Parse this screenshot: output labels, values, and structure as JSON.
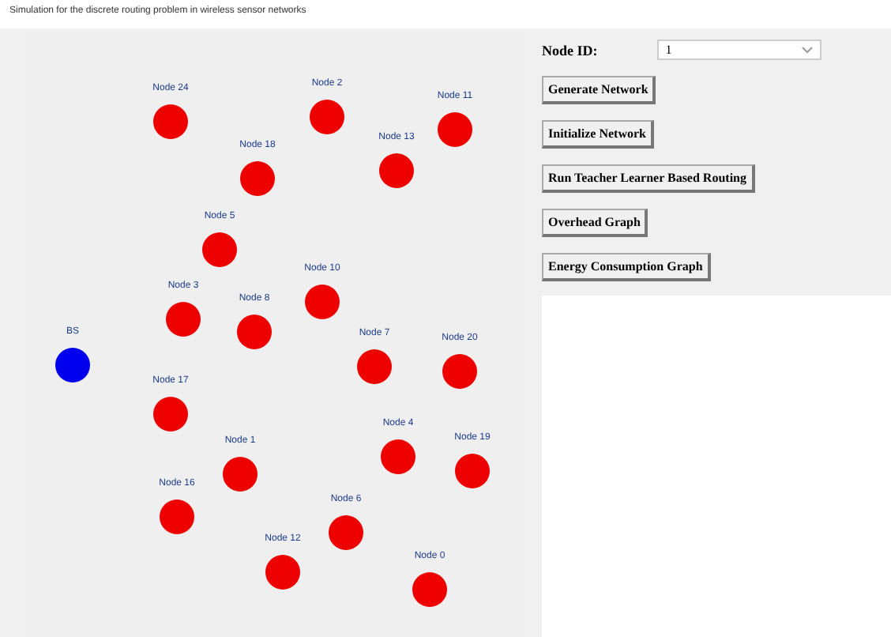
{
  "window": {
    "title": "Simulation for the discrete routing problem in wireless sensor networks"
  },
  "network": {
    "nodes": [
      {
        "label": "Node 24",
        "kind": "sensor"
      },
      {
        "label": "Node 2",
        "kind": "sensor"
      },
      {
        "label": "Node 11",
        "kind": "sensor"
      },
      {
        "label": "Node 18",
        "kind": "sensor"
      },
      {
        "label": "Node 13",
        "kind": "sensor"
      },
      {
        "label": "Node 5",
        "kind": "sensor"
      },
      {
        "label": "Node 3",
        "kind": "sensor"
      },
      {
        "label": "Node 8",
        "kind": "sensor"
      },
      {
        "label": "Node 10",
        "kind": "sensor"
      },
      {
        "label": "BS",
        "kind": "base_station"
      },
      {
        "label": "Node 7",
        "kind": "sensor"
      },
      {
        "label": "Node 20",
        "kind": "sensor"
      },
      {
        "label": "Node 17",
        "kind": "sensor"
      },
      {
        "label": "Node 4",
        "kind": "sensor"
      },
      {
        "label": "Node 19",
        "kind": "sensor"
      },
      {
        "label": "Node 1",
        "kind": "sensor"
      },
      {
        "label": "Node 16",
        "kind": "sensor"
      },
      {
        "label": "Node 6",
        "kind": "sensor"
      },
      {
        "label": "Node 12",
        "kind": "sensor"
      },
      {
        "label": "Node 0",
        "kind": "sensor"
      }
    ]
  },
  "controls": {
    "node_id": {
      "label": "Node ID:",
      "value": "1"
    },
    "buttons": [
      "Generate Network",
      "Initialize Network",
      "Run Teacher Learner Based Routing",
      "Overhead Graph",
      "Energy Consumption Graph"
    ]
  }
}
